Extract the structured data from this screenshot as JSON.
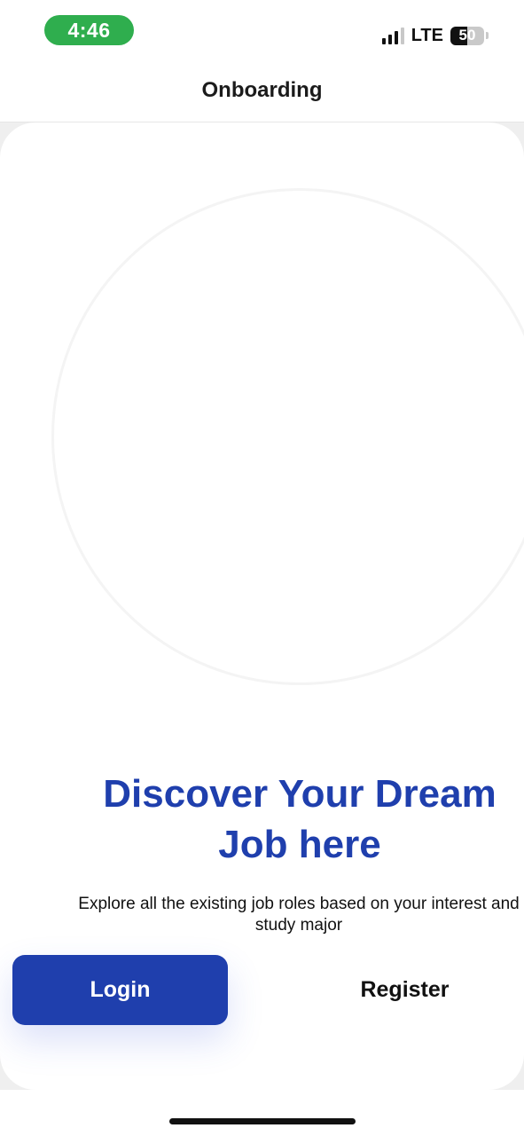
{
  "status_bar": {
    "time": "4:46",
    "network": "LTE",
    "battery_percent": "50",
    "signal_icon": "cellular-signal-icon",
    "battery_icon": "battery-icon",
    "time_pill_color": "#2fae4e"
  },
  "nav": {
    "title": "Onboarding"
  },
  "onboarding": {
    "headline_line1": "Discover Your Dream",
    "headline_line2": "Job here",
    "description": "Explore all the existing job roles based on your interest and study major"
  },
  "actions": {
    "login_label": "Login",
    "register_label": "Register"
  },
  "colors": {
    "primary": "#1f3fad",
    "text": "#111111"
  }
}
